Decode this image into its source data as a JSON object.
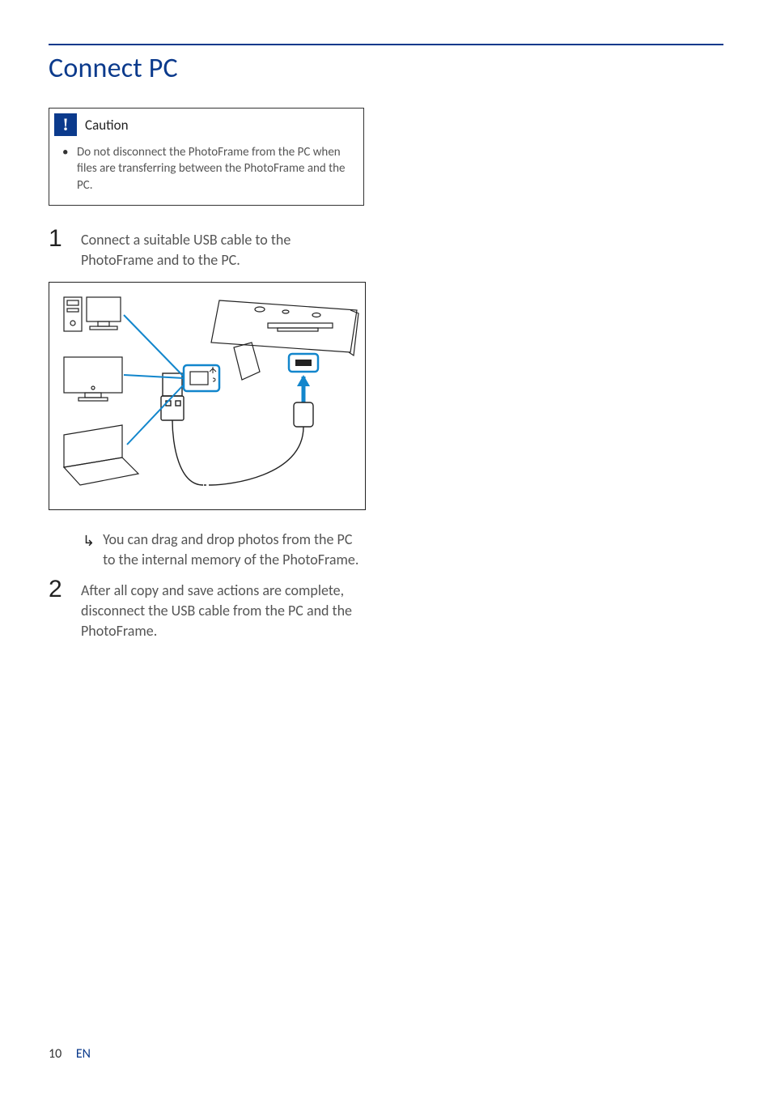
{
  "section": {
    "title": "Connect PC"
  },
  "caution": {
    "label": "Caution",
    "items": [
      "Do not disconnect the PhotoFrame from the PC when files are transferring between the PhotoFrame and the PC."
    ]
  },
  "steps": [
    {
      "num": "1",
      "text": "Connect a suitable USB cable to the PhotoFrame and to the PC.",
      "results": [
        "You can drag and drop photos from the PC to the internal memory of the PhotoFrame."
      ]
    },
    {
      "num": "2",
      "text": "After all copy and save actions are complete, disconnect the USB cable from the PC and the PhotoFrame."
    }
  ],
  "footer": {
    "page": "10",
    "lang": "EN"
  }
}
